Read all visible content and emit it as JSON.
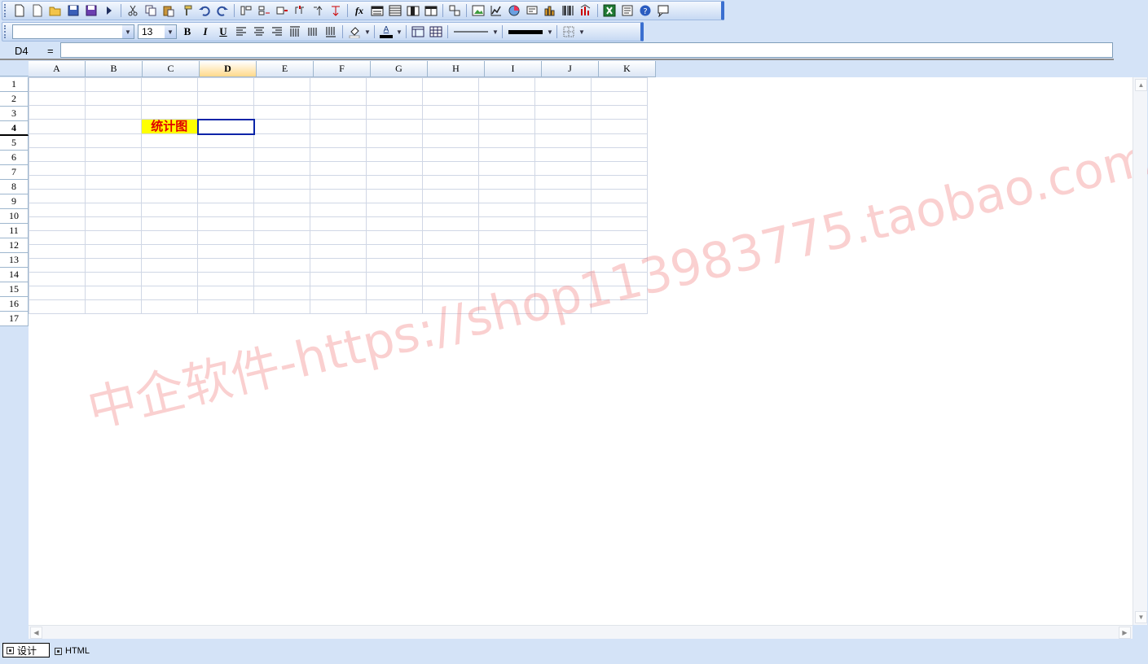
{
  "toolbar1": {
    "buttons": [
      "new-sheet",
      "new-file",
      "open",
      "save",
      "save-as",
      "run",
      "cut",
      "copy",
      "paste",
      "format-painter",
      "undo",
      "redo",
      "insert-row",
      "insert-column",
      "delete-row",
      "delete-column",
      "move-up",
      "move-down",
      "function",
      "report-header",
      "report-body",
      "report-footer",
      "report-group",
      "link",
      "image",
      "chart-line",
      "chart-pie",
      "fields",
      "bar-chart",
      "barcode",
      "vertical-bar",
      "excel-export",
      "preview",
      "help",
      "message"
    ],
    "function_label": "fx"
  },
  "toolbar2": {
    "font_name": "",
    "font_size": "13",
    "bold_label": "B",
    "italic_label": "I",
    "underline_label": "U",
    "fontcolor_label": "A"
  },
  "formula_bar": {
    "cell_ref": "D4",
    "equals": "=",
    "value": ""
  },
  "sheet": {
    "columns": [
      "A",
      "B",
      "C",
      "D",
      "E",
      "F",
      "G",
      "H",
      "I",
      "J",
      "K"
    ],
    "rows": [
      "1",
      "2",
      "3",
      "4",
      "5",
      "6",
      "7",
      "8",
      "9",
      "10",
      "11",
      "12",
      "13",
      "14",
      "15",
      "16",
      "17"
    ],
    "selected_column": "D",
    "selected_row": "4",
    "cells": {
      "C4": "统计图"
    },
    "label_fill": "#ffff00",
    "label_color": "#e00000",
    "active_border": "#0a24a8"
  },
  "tabs": {
    "design_label": "设计",
    "html_label": "HTML"
  },
  "watermark": "中企软件-https://shop113983775.taobao.com"
}
